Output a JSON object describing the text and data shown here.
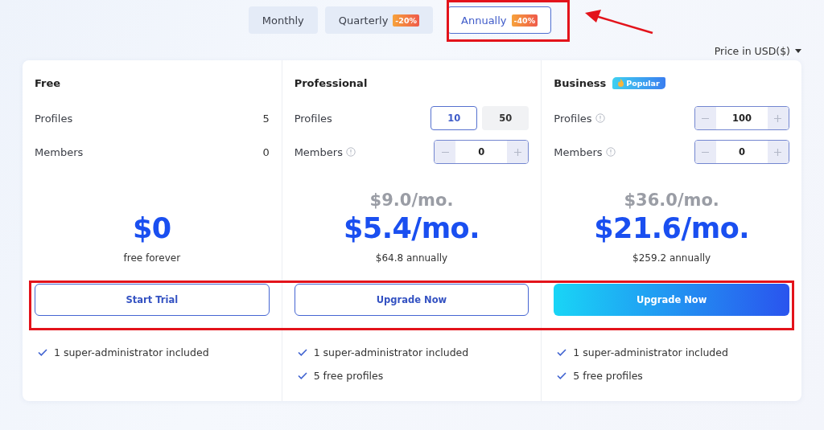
{
  "billing_tabs": [
    {
      "label": "Monthly",
      "selected": false
    },
    {
      "label": "Quarterly",
      "badge": "-20%",
      "selected": false
    },
    {
      "label": "Annually",
      "badge": "-40%",
      "selected": true
    }
  ],
  "currency_selector": {
    "label": "Price in USD($)"
  },
  "plans": [
    {
      "name": "Free",
      "rows": [
        {
          "label": "Profiles",
          "info": false,
          "kind": "text",
          "value": "5"
        },
        {
          "label": "Members",
          "info": false,
          "kind": "text",
          "value": "0"
        }
      ],
      "price": "$0",
      "note": "free forever",
      "button": {
        "label": "Start Trial",
        "kind": "outline"
      },
      "features": [
        "1 super-administrator included"
      ]
    },
    {
      "name": "Professional",
      "rows": [
        {
          "label": "Profiles",
          "info": false,
          "kind": "options",
          "options": [
            {
              "label": "10",
              "selected": true
            },
            {
              "label": "50",
              "selected": false
            }
          ]
        },
        {
          "label": "Members",
          "info": true,
          "kind": "stepper",
          "value": "0"
        }
      ],
      "old_price": "$9.0/mo.",
      "price": "$5.4/mo.",
      "note": "$64.8 annually",
      "button": {
        "label": "Upgrade Now",
        "kind": "outline"
      },
      "features": [
        "1 super-administrator included",
        "5 free profiles"
      ]
    },
    {
      "name": "Business",
      "badge": "Popular",
      "rows": [
        {
          "label": "Profiles",
          "info": true,
          "kind": "stepper",
          "value": "100"
        },
        {
          "label": "Members",
          "info": true,
          "kind": "stepper",
          "value": "0"
        }
      ],
      "old_price": "$36.0/mo.",
      "price": "$21.6/mo.",
      "note": "$259.2 annually",
      "button": {
        "label": "Upgrade Now",
        "kind": "filled"
      },
      "features": [
        "1 super-administrator included",
        "5 free profiles"
      ]
    }
  ]
}
